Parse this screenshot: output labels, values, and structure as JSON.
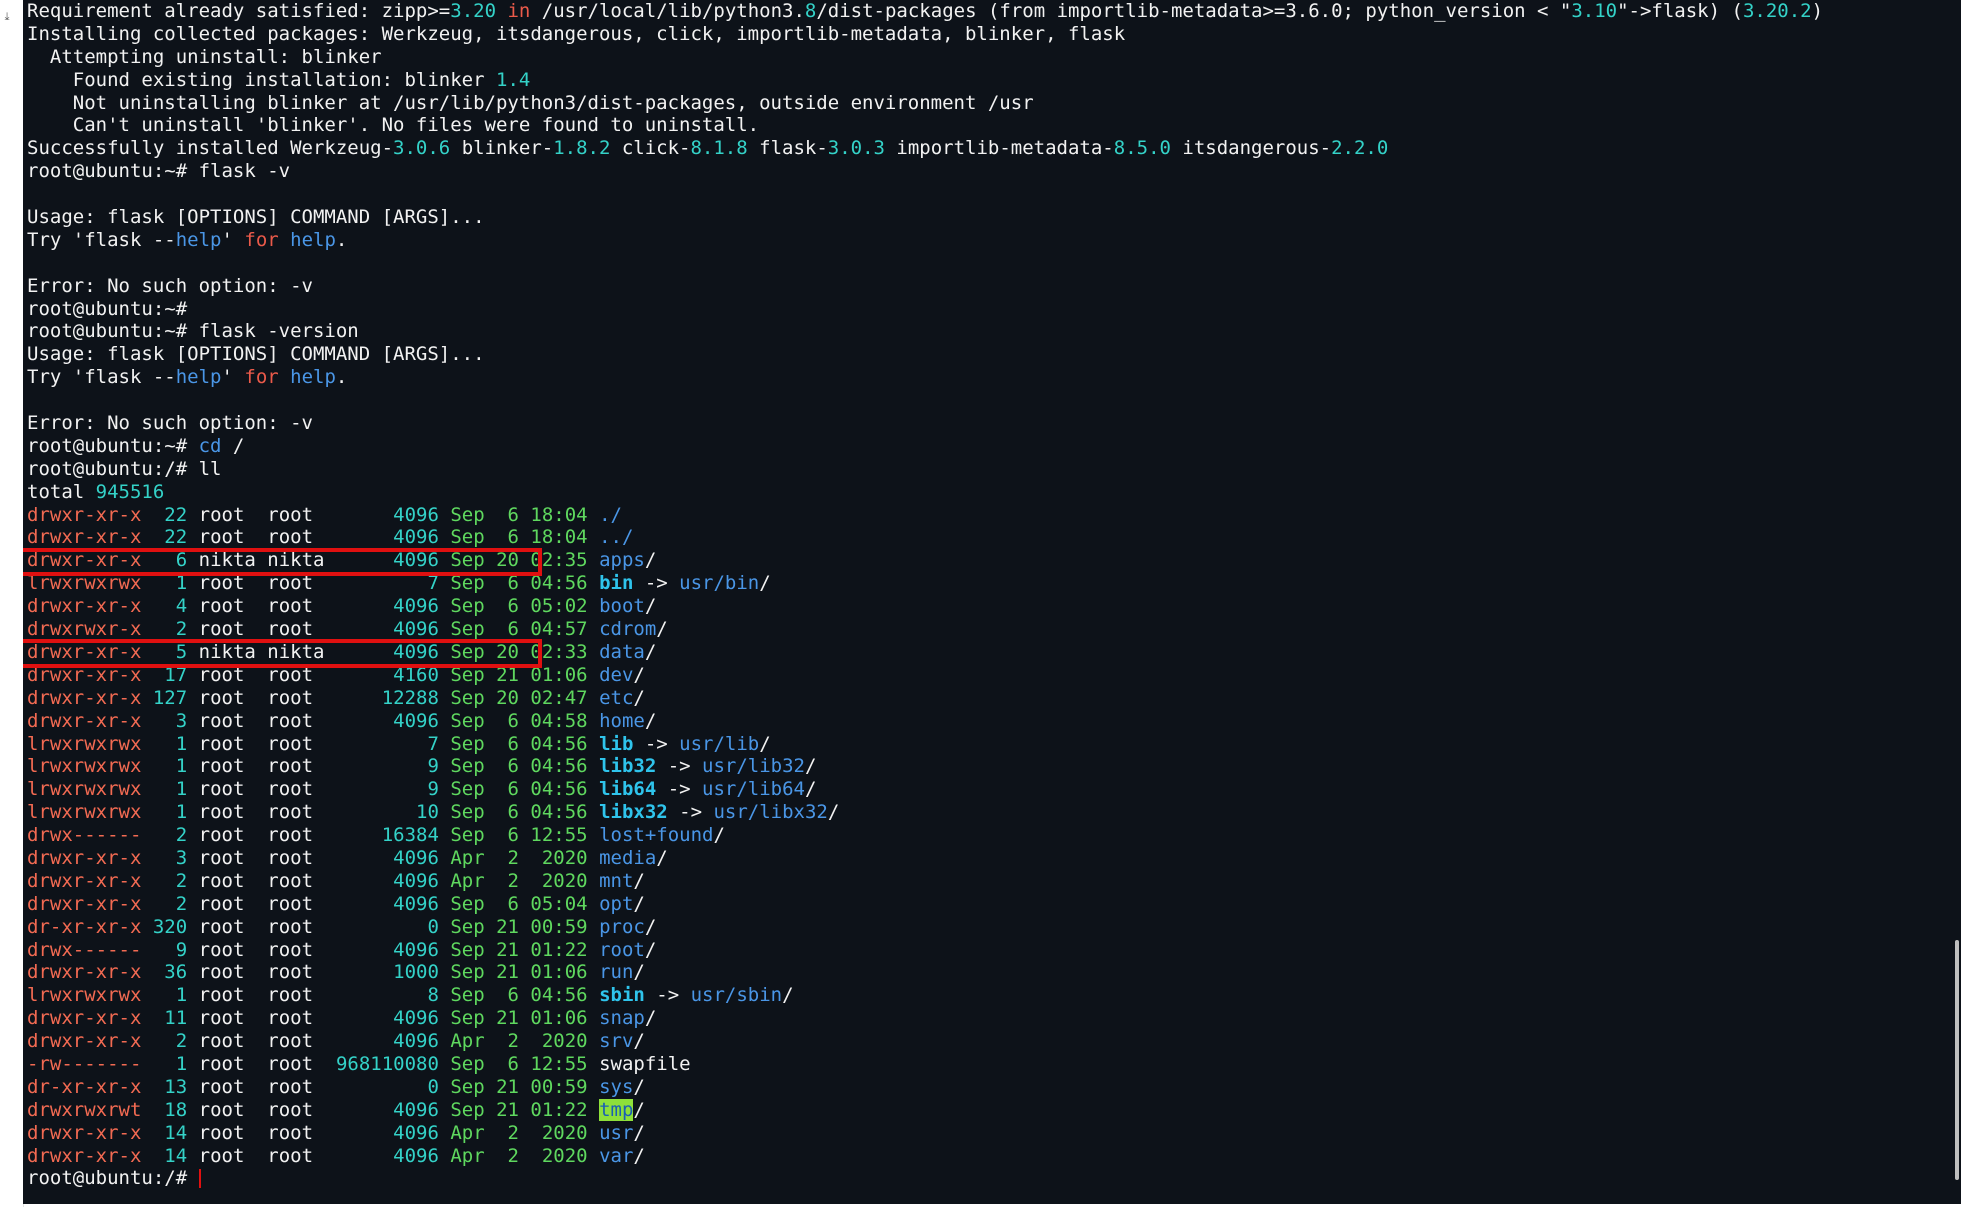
{
  "pre_install_lines": [
    [
      [
        "Requirement already satisfied: zipp>=",
        "w"
      ],
      [
        "3.20",
        "n"
      ],
      [
        " ",
        "w"
      ],
      [
        "in",
        "k"
      ],
      [
        " /usr/local/lib/python3.",
        "w"
      ],
      [
        "8",
        "n"
      ],
      [
        "/dist-packages (from importlib-metadata>=3.6.0; python_version < \"",
        "w"
      ],
      [
        "3.10",
        "n"
      ],
      [
        "\"->flask) (",
        "w"
      ],
      [
        "3.20.2",
        "n"
      ],
      [
        ")",
        "w"
      ]
    ],
    [
      [
        "Installing collected packages: Werkzeug, itsdangerous, click, importlib-metadata, blinker, flask",
        "w"
      ]
    ],
    [
      [
        "  Attempting uninstall: blinker",
        "w"
      ]
    ],
    [
      [
        "    Found existing installation: blinker ",
        "w"
      ],
      [
        "1.4",
        "n"
      ]
    ],
    [
      [
        "    Not uninstalling blinker at /usr/lib/python3/dist-packages, outside environment /usr",
        "w"
      ]
    ],
    [
      [
        "    Can't uninstall 'blinker'. No files were found to uninstall.",
        "w"
      ]
    ],
    [
      [
        "Successfully installed Werkzeug-",
        "w"
      ],
      [
        "3.0.6",
        "n"
      ],
      [
        " blinker-",
        "w"
      ],
      [
        "1.8.2",
        "n"
      ],
      [
        " click-",
        "w"
      ],
      [
        "8.1.8",
        "n"
      ],
      [
        " flask-",
        "w"
      ],
      [
        "3.0.3",
        "n"
      ],
      [
        " importlib-metadata-",
        "w"
      ],
      [
        "8.5.0",
        "n"
      ],
      [
        " itsdangerous-",
        "w"
      ],
      [
        "2.2.0",
        "n"
      ]
    ],
    [
      [
        "root@ubuntu:~# flask -v",
        "w"
      ]
    ],
    [],
    [
      [
        "Usage: flask [OPTIONS] COMMAND [ARGS]...",
        "w"
      ]
    ],
    [
      [
        "Try 'flask --",
        "w"
      ],
      [
        "help",
        "b"
      ],
      [
        "' ",
        "w"
      ],
      [
        "for",
        "k"
      ],
      [
        " ",
        "w"
      ],
      [
        "help",
        "b"
      ],
      [
        ".",
        "w"
      ]
    ],
    [],
    [
      [
        "Error: No such option: -v",
        "w"
      ]
    ],
    [
      [
        "root@ubuntu:~#",
        "w"
      ]
    ],
    [
      [
        "root@ubuntu:~# flask -version",
        "w"
      ]
    ],
    [
      [
        "Usage: flask [OPTIONS] COMMAND [ARGS]...",
        "w"
      ]
    ],
    [
      [
        "Try 'flask --",
        "w"
      ],
      [
        "help",
        "b"
      ],
      [
        "' ",
        "w"
      ],
      [
        "for",
        "k"
      ],
      [
        " ",
        "w"
      ],
      [
        "help",
        "b"
      ],
      [
        ".",
        "w"
      ]
    ],
    [],
    [
      [
        "Error: No such option: -v",
        "w"
      ]
    ],
    [
      [
        "root@ubuntu:~# ",
        "w"
      ],
      [
        "cd",
        "b"
      ],
      [
        " /",
        "w"
      ]
    ],
    [
      [
        "root@ubuntu:/# ll",
        "w"
      ]
    ],
    [
      [
        "total ",
        "w"
      ],
      [
        "945516",
        "n"
      ]
    ]
  ],
  "listing": [
    {
      "perm": "drwxr-xr-x",
      "links": "22",
      "owner": "root",
      "group": "root",
      "size": "4096",
      "date": "Sep  6 18:04",
      "segs": [
        [
          "./",
          "b"
        ]
      ]
    },
    {
      "perm": "drwxr-xr-x",
      "links": "22",
      "owner": "root",
      "group": "root",
      "size": "4096",
      "date": "Sep  6 18:04",
      "segs": [
        [
          "../",
          "b"
        ]
      ]
    },
    {
      "perm": "drwxr-xr-x",
      "links": "6",
      "owner": "nikta",
      "group": "nikta",
      "size": "4096",
      "date": "Sep 20 02:35",
      "segs": [
        [
          "apps",
          "b"
        ],
        [
          "/",
          "w"
        ]
      ]
    },
    {
      "perm": "lrwxrwxrwx",
      "links": "1",
      "owner": "root",
      "group": "root",
      "size": "7",
      "date": "Sep  6 04:56",
      "segs": [
        [
          "bin",
          "c"
        ],
        [
          " -> ",
          "w"
        ],
        [
          "usr/bin",
          "b"
        ],
        [
          "/",
          "w"
        ]
      ]
    },
    {
      "perm": "drwxr-xr-x",
      "links": "4",
      "owner": "root",
      "group": "root",
      "size": "4096",
      "date": "Sep  6 05:02",
      "segs": [
        [
          "boot",
          "b"
        ],
        [
          "/",
          "w"
        ]
      ]
    },
    {
      "perm": "drwxrwxr-x",
      "links": "2",
      "owner": "root",
      "group": "root",
      "size": "4096",
      "date": "Sep  6 04:57",
      "segs": [
        [
          "cdrom",
          "b"
        ],
        [
          "/",
          "w"
        ]
      ]
    },
    {
      "perm": "drwxr-xr-x",
      "links": "5",
      "owner": "nikta",
      "group": "nikta",
      "size": "4096",
      "date": "Sep 20 02:33",
      "segs": [
        [
          "data",
          "b"
        ],
        [
          "/",
          "w"
        ]
      ]
    },
    {
      "perm": "drwxr-xr-x",
      "links": "17",
      "owner": "root",
      "group": "root",
      "size": "4160",
      "date": "Sep 21 01:06",
      "segs": [
        [
          "dev",
          "b"
        ],
        [
          "/",
          "w"
        ]
      ]
    },
    {
      "perm": "drwxr-xr-x",
      "links": "127",
      "owner": "root",
      "group": "root",
      "size": "12288",
      "date": "Sep 20 02:47",
      "segs": [
        [
          "etc",
          "b"
        ],
        [
          "/",
          "w"
        ]
      ]
    },
    {
      "perm": "drwxr-xr-x",
      "links": "3",
      "owner": "root",
      "group": "root",
      "size": "4096",
      "date": "Sep  6 04:58",
      "segs": [
        [
          "home",
          "b"
        ],
        [
          "/",
          "w"
        ]
      ]
    },
    {
      "perm": "lrwxrwxrwx",
      "links": "1",
      "owner": "root",
      "group": "root",
      "size": "7",
      "date": "Sep  6 04:56",
      "segs": [
        [
          "lib",
          "c"
        ],
        [
          " -> ",
          "w"
        ],
        [
          "usr/lib",
          "b"
        ],
        [
          "/",
          "w"
        ]
      ]
    },
    {
      "perm": "lrwxrwxrwx",
      "links": "1",
      "owner": "root",
      "group": "root",
      "size": "9",
      "date": "Sep  6 04:56",
      "segs": [
        [
          "lib32",
          "c"
        ],
        [
          " -> ",
          "w"
        ],
        [
          "usr/lib32",
          "b"
        ],
        [
          "/",
          "w"
        ]
      ]
    },
    {
      "perm": "lrwxrwxrwx",
      "links": "1",
      "owner": "root",
      "group": "root",
      "size": "9",
      "date": "Sep  6 04:56",
      "segs": [
        [
          "lib64",
          "c"
        ],
        [
          " -> ",
          "w"
        ],
        [
          "usr/lib64",
          "b"
        ],
        [
          "/",
          "w"
        ]
      ]
    },
    {
      "perm": "lrwxrwxrwx",
      "links": "1",
      "owner": "root",
      "group": "root",
      "size": "10",
      "date": "Sep  6 04:56",
      "segs": [
        [
          "libx32",
          "c"
        ],
        [
          " -> ",
          "w"
        ],
        [
          "usr/libx32",
          "b"
        ],
        [
          "/",
          "w"
        ]
      ]
    },
    {
      "perm": "drwx------",
      "links": "2",
      "owner": "root",
      "group": "root",
      "size": "16384",
      "date": "Sep  6 12:55",
      "segs": [
        [
          "lost+found",
          "b"
        ],
        [
          "/",
          "w"
        ]
      ]
    },
    {
      "perm": "drwxr-xr-x",
      "links": "3",
      "owner": "root",
      "group": "root",
      "size": "4096",
      "date": "Apr  2  2020",
      "segs": [
        [
          "media",
          "b"
        ],
        [
          "/",
          "w"
        ]
      ]
    },
    {
      "perm": "drwxr-xr-x",
      "links": "2",
      "owner": "root",
      "group": "root",
      "size": "4096",
      "date": "Apr  2  2020",
      "segs": [
        [
          "mnt",
          "b"
        ],
        [
          "/",
          "w"
        ]
      ]
    },
    {
      "perm": "drwxr-xr-x",
      "links": "2",
      "owner": "root",
      "group": "root",
      "size": "4096",
      "date": "Sep  6 05:04",
      "segs": [
        [
          "opt",
          "b"
        ],
        [
          "/",
          "w"
        ]
      ]
    },
    {
      "perm": "dr-xr-xr-x",
      "links": "320",
      "owner": "root",
      "group": "root",
      "size": "0",
      "date": "Sep 21 00:59",
      "segs": [
        [
          "proc",
          "b"
        ],
        [
          "/",
          "w"
        ]
      ]
    },
    {
      "perm": "drwx------",
      "links": "9",
      "owner": "root",
      "group": "root",
      "size": "4096",
      "date": "Sep 21 01:22",
      "segs": [
        [
          "root",
          "b"
        ],
        [
          "/",
          "w"
        ]
      ]
    },
    {
      "perm": "drwxr-xr-x",
      "links": "36",
      "owner": "root",
      "group": "root",
      "size": "1000",
      "date": "Sep 21 01:06",
      "segs": [
        [
          "run",
          "b"
        ],
        [
          "/",
          "w"
        ]
      ]
    },
    {
      "perm": "lrwxrwxrwx",
      "links": "1",
      "owner": "root",
      "group": "root",
      "size": "8",
      "date": "Sep  6 04:56",
      "segs": [
        [
          "sbin",
          "c"
        ],
        [
          " -> ",
          "w"
        ],
        [
          "usr/sbin",
          "b"
        ],
        [
          "/",
          "w"
        ]
      ]
    },
    {
      "perm": "drwxr-xr-x",
      "links": "11",
      "owner": "root",
      "group": "root",
      "size": "4096",
      "date": "Sep 21 01:06",
      "segs": [
        [
          "snap",
          "b"
        ],
        [
          "/",
          "w"
        ]
      ]
    },
    {
      "perm": "drwxr-xr-x",
      "links": "2",
      "owner": "root",
      "group": "root",
      "size": "4096",
      "date": "Apr  2  2020",
      "segs": [
        [
          "srv",
          "b"
        ],
        [
          "/",
          "w"
        ]
      ]
    },
    {
      "perm": "-rw-------",
      "links": "1",
      "owner": "root",
      "group": "root",
      "size": "968110080",
      "date": "Sep  6 12:55",
      "segs": [
        [
          "swapfile",
          "w"
        ]
      ]
    },
    {
      "perm": "dr-xr-xr-x",
      "links": "13",
      "owner": "root",
      "group": "root",
      "size": "0",
      "date": "Sep 21 00:59",
      "segs": [
        [
          "sys",
          "b"
        ],
        [
          "/",
          "w"
        ]
      ]
    },
    {
      "perm": "drwxrwxrwt",
      "links": "18",
      "owner": "root",
      "group": "root",
      "size": "4096",
      "date": "Sep 21 01:22",
      "segs": [
        [
          "tmp",
          "tmp"
        ],
        [
          "/",
          "w"
        ]
      ]
    },
    {
      "perm": "drwxr-xr-x",
      "links": "14",
      "owner": "root",
      "group": "root",
      "size": "4096",
      "date": "Apr  2  2020",
      "segs": [
        [
          "usr",
          "b"
        ],
        [
          "/",
          "w"
        ]
      ]
    },
    {
      "perm": "drwxr-xr-x",
      "links": "14",
      "owner": "root",
      "group": "root",
      "size": "4096",
      "date": "Apr  2  2020",
      "segs": [
        [
          "var",
          "b"
        ],
        [
          "/",
          "w"
        ]
      ]
    }
  ],
  "final_prompt": "root@ubuntu:/# ",
  "highlighted_entries": [
    "apps",
    "data"
  ],
  "colors": {
    "background": "#0d1219",
    "text": "#f2f2f2",
    "number": "#34d2c8",
    "keyword": "#ea5a4a",
    "directory": "#4a96e6",
    "symlink": "#2fc4ec",
    "permissions": "#f26a52",
    "highlight_box": "#e01010",
    "cursor": "#e01010"
  },
  "gutter_icon": "download-icon"
}
